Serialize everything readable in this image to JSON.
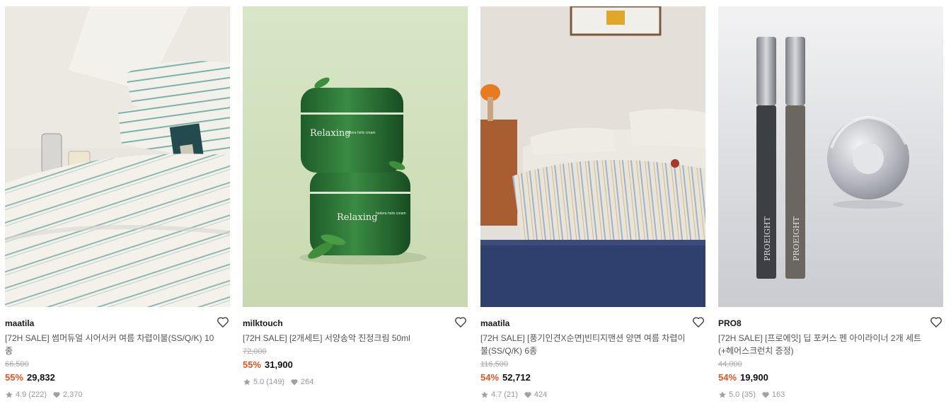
{
  "products": [
    {
      "brand": "maatila",
      "title": "[72H SALE] 썸머듀얼 시어서커 여름 차렵이불(SS/Q/K) 10종",
      "original_price": "66,500",
      "discount": "55%",
      "price": "29,832",
      "rating": "4.9",
      "reviews": "(222)",
      "likes": "2,370",
      "image": "striped-bedding-photo"
    },
    {
      "brand": "milktouch",
      "title": "[72H SALE] [2개세트] 서양송악 진정크림 50ml",
      "original_price": "72,000",
      "discount": "55%",
      "price": "31,900",
      "rating": "5.0",
      "reviews": "(149)",
      "likes": "264",
      "image": "green-cream-jars-photo",
      "jar_label": "Relaxing",
      "jar_sub": "hedera helix cream"
    },
    {
      "brand": "maatila",
      "title": "[72H SALE] [풍기인견X순면]빈티지맨션 양면 여름 차렵이불(SS/Q/K) 6종",
      "original_price": "116,500",
      "discount": "54%",
      "price": "52,712",
      "rating": "4.7",
      "reviews": "(21)",
      "likes": "424",
      "image": "bedroom-bedding-photo"
    },
    {
      "brand": "PRO8",
      "title": "[72H SALE] [프로에잇] 딥 포커스 펜 아이라이너 2개 세트 (+헤어스크런치 증정)",
      "original_price": "44,000",
      "discount": "54%",
      "price": "19,900",
      "rating": "5.0",
      "reviews": "(35)",
      "likes": "163",
      "image": "eyeliner-pens-scrunchie-photo",
      "pen_label": "PROEIGHT"
    }
  ],
  "colors": {
    "discount": "#e8531f",
    "price": "#111111",
    "muted": "#999999"
  },
  "icons": {
    "wishlist": "heart-outline-icon",
    "rating": "star-icon",
    "likes": "heart-filled-icon"
  }
}
